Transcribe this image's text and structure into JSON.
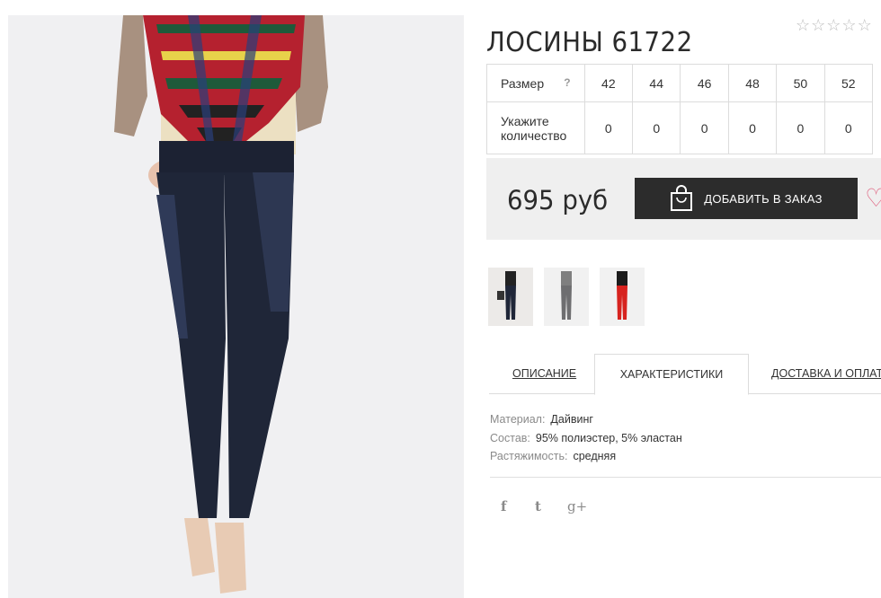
{
  "product": {
    "title": "ЛОСИНЫ 61722",
    "rating_stars": [
      "☆",
      "☆",
      "☆",
      "☆",
      "☆"
    ]
  },
  "size_table": {
    "size_label": "Размер",
    "help_mark": "?",
    "sizes": [
      "42",
      "44",
      "46",
      "48",
      "50",
      "52"
    ],
    "qty_label": "Укажите количество",
    "quantities": [
      "0",
      "0",
      "0",
      "0",
      "0",
      "0"
    ]
  },
  "buy": {
    "price": "695 руб",
    "add_to_order": "ДОБАВИТЬ В ЗАКАЗ",
    "heart": "♡"
  },
  "tabs": [
    "ОПИСАНИЕ",
    "ХАРАКТЕРИСТИКИ",
    "ДОСТАВКА И ОПЛАТА"
  ],
  "specs": [
    {
      "key": "Материал:",
      "value": "Дайвинг"
    },
    {
      "key": "Состав:",
      "value": "95% полиэстер, 5% эластан"
    },
    {
      "key": "Растяжимость:",
      "value": "средняя"
    }
  ],
  "social": [
    "f",
    "t",
    "g+"
  ],
  "colors": {
    "button_bg": "#2c2c2c",
    "buybox_bg": "#efefef",
    "heart": "#e06a86",
    "pants": "#1f2638",
    "scarf_red": "#b5212f",
    "thumb3_red": "#d7231f"
  }
}
